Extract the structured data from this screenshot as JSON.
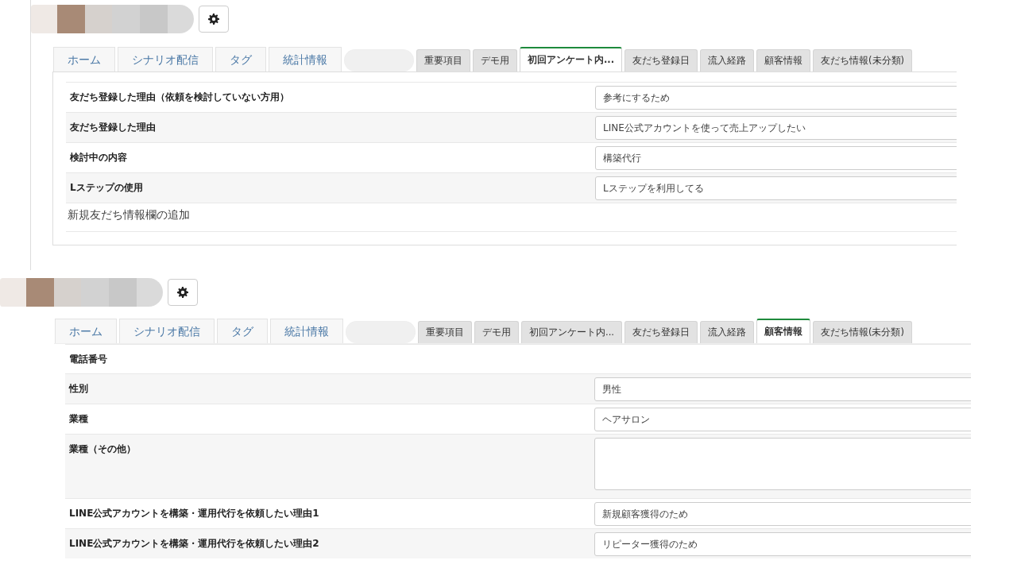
{
  "panels": [
    {
      "tabs": [
        {
          "label": "ホーム",
          "kind": "main",
          "selected": false
        },
        {
          "label": "シナリオ配信",
          "kind": "main",
          "selected": false
        },
        {
          "label": "タグ",
          "kind": "main",
          "selected": false
        },
        {
          "label": "統計情報",
          "kind": "main",
          "selected": false
        },
        {
          "kind": "blank",
          "selected": false
        },
        {
          "label": "重要項目",
          "kind": "sub",
          "selected": false
        },
        {
          "label": "デモ用",
          "kind": "sub",
          "selected": false
        },
        {
          "label": "初回アンケート内...",
          "kind": "sub",
          "selected": true
        },
        {
          "label": "友だち登録日",
          "kind": "sub",
          "selected": false
        },
        {
          "label": "流入経路",
          "kind": "sub",
          "selected": false
        },
        {
          "label": "顧客情報",
          "kind": "sub",
          "selected": false
        },
        {
          "label": "友だち情報(未分類)",
          "kind": "sub",
          "selected": false
        }
      ],
      "rows": [
        {
          "label": "友だち登録した理由（依頼を検討していない方用）",
          "kind": "input",
          "value": "参考にするため"
        },
        {
          "label": "友だち登録した理由",
          "kind": "input",
          "value": "LINE公式アカウントを使って売上アップしたい"
        },
        {
          "label": "検討中の内容",
          "kind": "input",
          "value": "構築代行"
        },
        {
          "label": "Lステップの使用",
          "kind": "input",
          "value": "Lステップを利用してる"
        }
      ],
      "add_link": "新規友だち情報欄の追加"
    },
    {
      "tabs": [
        {
          "label": "ホーム",
          "kind": "main",
          "selected": false
        },
        {
          "label": "シナリオ配信",
          "kind": "main",
          "selected": false
        },
        {
          "label": "タグ",
          "kind": "main",
          "selected": false
        },
        {
          "label": "統計情報",
          "kind": "main",
          "selected": false
        },
        {
          "kind": "blank",
          "selected": false
        },
        {
          "label": "重要項目",
          "kind": "sub",
          "selected": false
        },
        {
          "label": "デモ用",
          "kind": "sub",
          "selected": false
        },
        {
          "label": "初回アンケート内...",
          "kind": "sub",
          "selected": false
        },
        {
          "label": "友だち登録日",
          "kind": "sub",
          "selected": false
        },
        {
          "label": "流入経路",
          "kind": "sub",
          "selected": false
        },
        {
          "label": "顧客情報",
          "kind": "sub",
          "selected": true
        },
        {
          "label": "友だち情報(未分類)",
          "kind": "sub",
          "selected": false
        }
      ],
      "rows": [
        {
          "label": "電話番号",
          "kind": "hidden"
        },
        {
          "label": "性別",
          "kind": "input",
          "value": "男性"
        },
        {
          "label": "業種",
          "kind": "input",
          "value": "ヘアサロン"
        },
        {
          "label": "業種（その他）",
          "kind": "textarea"
        },
        {
          "label": "LINE公式アカウントを構築・運用代行を依頼したい理由1",
          "kind": "input",
          "value": "新規顧客獲得のため"
        },
        {
          "label": "LINE公式アカウントを構築・運用代行を依頼したい理由2",
          "kind": "input",
          "value": "リピーター獲得のため"
        }
      ]
    }
  ]
}
